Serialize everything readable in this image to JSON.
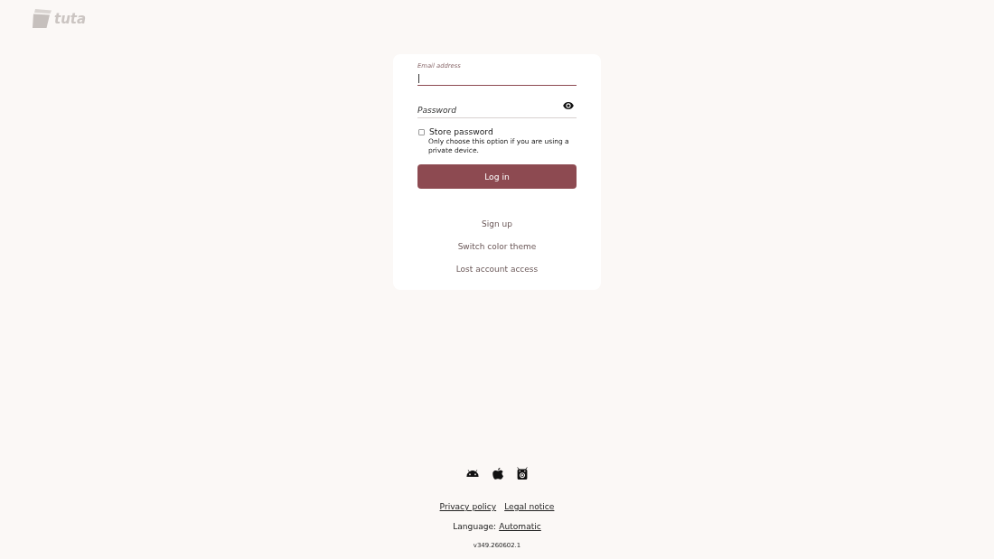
{
  "logo": {
    "text": "tuta"
  },
  "login_form": {
    "email_field": {
      "label": "Email address",
      "focused": true
    },
    "password_field": {
      "placeholder": "Password",
      "focused": false
    },
    "store_password": {
      "label": "Store password",
      "hint": "Only choose this option if you are using a private device.",
      "checked": false
    },
    "login_button": "Log in",
    "links": [
      "Sign up",
      "Switch color theme",
      "Lost account access"
    ]
  },
  "footer": {
    "links": [
      "Privacy policy",
      "Legal notice"
    ],
    "language": {
      "label": "Language:",
      "value": "Automatic"
    },
    "version": "v349.260602.1"
  }
}
